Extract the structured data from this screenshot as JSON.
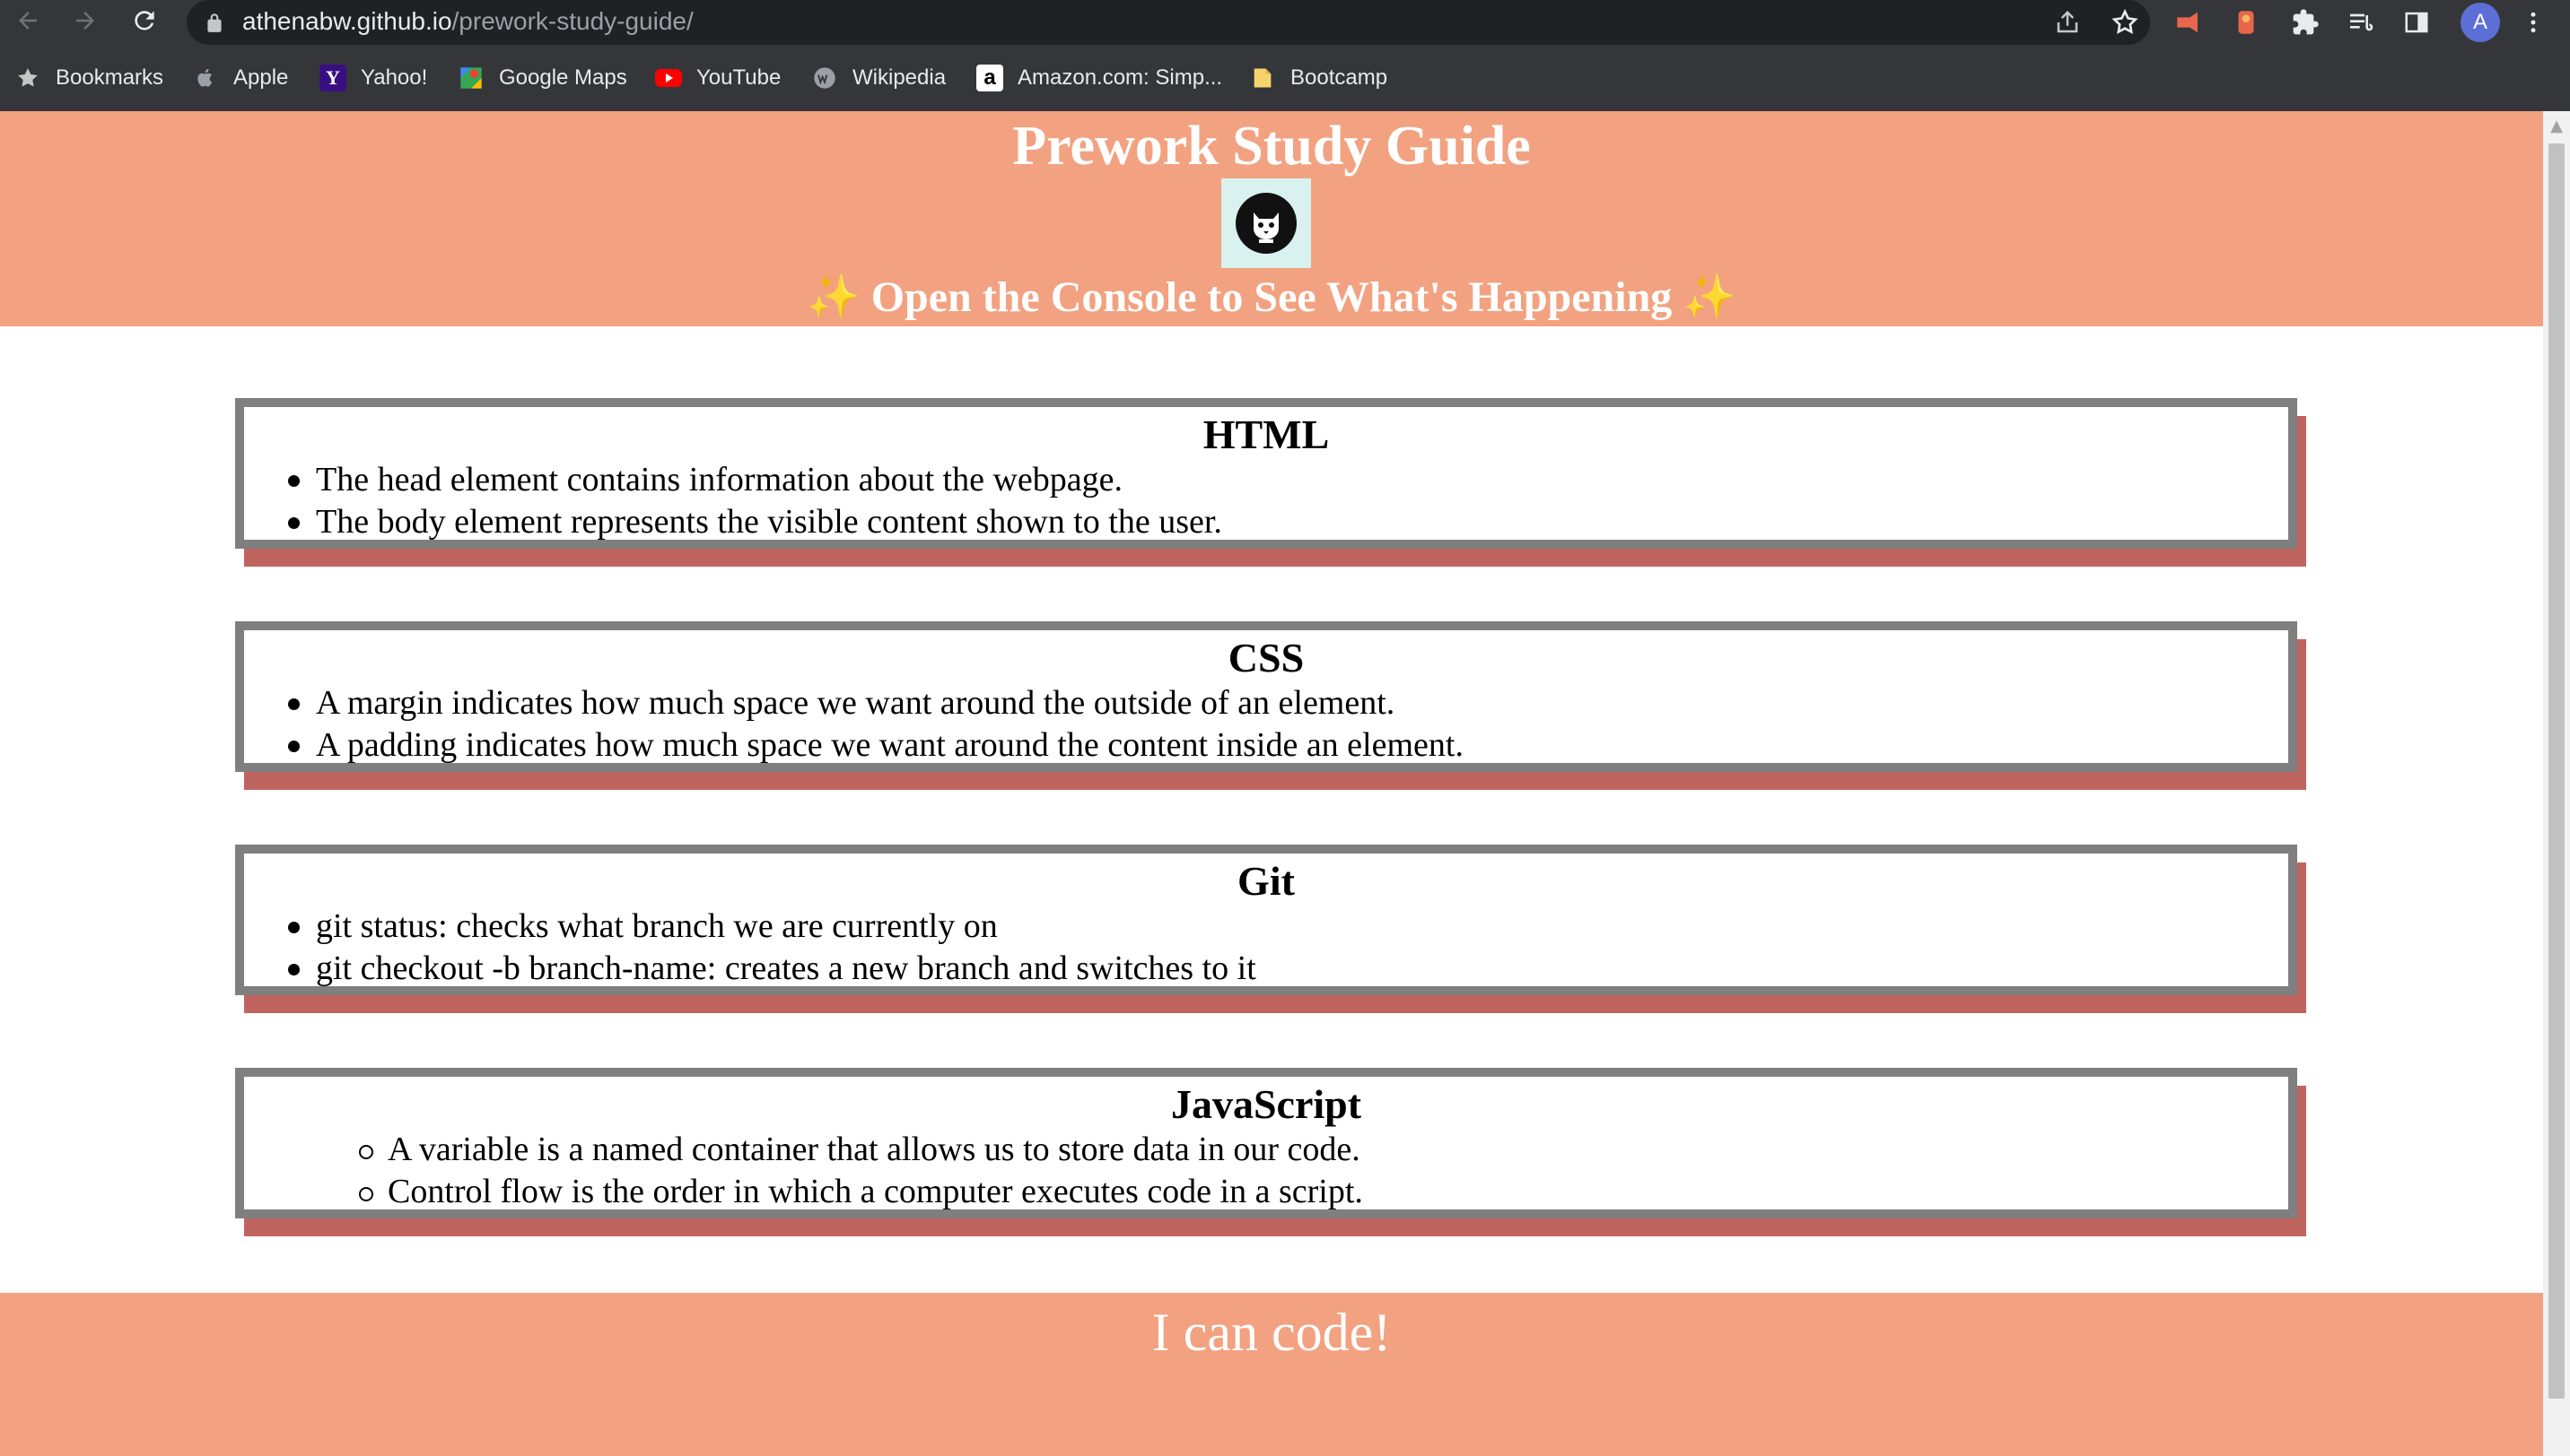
{
  "browser": {
    "url_host": "athenabw.github.io",
    "url_path": "/prework-study-guide/",
    "profile_initial": "A",
    "nav_icons": [
      "back-arrow-icon",
      "forward-arrow-icon",
      "reload-icon"
    ],
    "toolbar_icons": [
      "share-icon",
      "star-icon",
      "extension-red-icon",
      "extension-orange-icon",
      "puzzle-icon",
      "reading-list-icon",
      "side-panel-icon",
      "menu-dots-icon"
    ]
  },
  "bookmarks": [
    {
      "label": "Bookmarks",
      "icon": "star-icon"
    },
    {
      "label": "Apple",
      "icon": "apple-icon"
    },
    {
      "label": "Yahoo!",
      "icon": "yahoo-icon"
    },
    {
      "label": "Google Maps",
      "icon": "google-maps-icon"
    },
    {
      "label": "YouTube",
      "icon": "youtube-icon"
    },
    {
      "label": "Wikipedia",
      "icon": "wikipedia-icon"
    },
    {
      "label": "Amazon.com: Simp...",
      "icon": "amazon-icon"
    },
    {
      "label": "Bootcamp",
      "icon": "folder-icon"
    }
  ],
  "page": {
    "title": "Prework Study Guide",
    "subtitle_spark": "✨",
    "subtitle": "Open the Console to See What's Happening",
    "sections": [
      {
        "title": "HTML",
        "items": [
          "The head element contains information about the webpage.",
          "The body element represents the visible content shown to the user."
        ]
      },
      {
        "title": "CSS",
        "items": [
          "A margin indicates how much space we want around the outside of an element.",
          "A padding indicates how much space we want around the content inside an element."
        ]
      },
      {
        "title": "Git",
        "items": [
          "git status: checks what branch we are currently on",
          "git checkout -b branch-name: creates a new branch and switches to it"
        ]
      },
      {
        "title": "JavaScript",
        "items": [
          "A variable is a named container that allows us to store data in our code.",
          "Control flow is the order in which a computer executes code in a script."
        ]
      }
    ],
    "footer": "I can code!"
  },
  "colors": {
    "header_bg": "#f2a281",
    "card_border": "#7f7f7f",
    "card_shadow": "#c0645f",
    "chrome_bg": "#35363a"
  }
}
